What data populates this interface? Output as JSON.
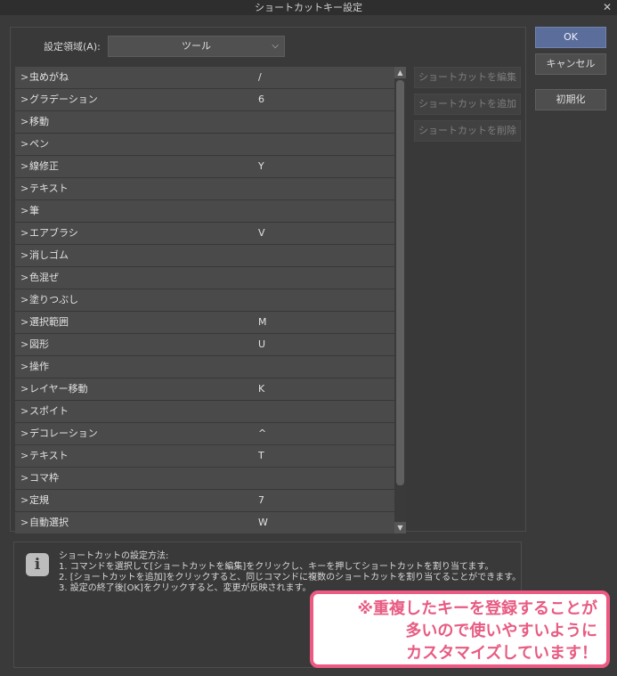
{
  "window": {
    "title": "ショートカットキー設定",
    "close_glyph": "✕"
  },
  "area": {
    "label": "設定領域(A):",
    "selected": "ツール",
    "chevron": "⌵"
  },
  "list": {
    "arrow": ">",
    "items": [
      {
        "name": "虫めがね",
        "key": "/"
      },
      {
        "name": "グラデーション",
        "key": "6"
      },
      {
        "name": "移動",
        "key": ""
      },
      {
        "name": "ペン",
        "key": ""
      },
      {
        "name": "線修正",
        "key": "Y"
      },
      {
        "name": "テキスト",
        "key": ""
      },
      {
        "name": "筆",
        "key": ""
      },
      {
        "name": "エアブラシ",
        "key": "V"
      },
      {
        "name": "消しゴム",
        "key": ""
      },
      {
        "name": "色混ぜ",
        "key": ""
      },
      {
        "name": "塗りつぶし",
        "key": ""
      },
      {
        "name": "選択範囲",
        "key": "M"
      },
      {
        "name": "図形",
        "key": "U"
      },
      {
        "name": "操作",
        "key": ""
      },
      {
        "name": "レイヤー移動",
        "key": "K"
      },
      {
        "name": "スポイト",
        "key": ""
      },
      {
        "name": "デコレーション",
        "key": "^"
      },
      {
        "name": "テキスト",
        "key": "T"
      },
      {
        "name": "コマ枠",
        "key": ""
      },
      {
        "name": "定規",
        "key": "7"
      },
      {
        "name": "自動選択",
        "key": "W"
      }
    ]
  },
  "scroll": {
    "up": "▲",
    "down": "▼"
  },
  "actions": {
    "edit": "ショートカットを編集",
    "add": "ショートカットを追加",
    "delete": "ショートカットを削除"
  },
  "buttons": {
    "ok": "OK",
    "cancel": "キャンセル",
    "reset": "初期化"
  },
  "info": {
    "icon": "i",
    "lines": [
      "ショートカットの設定方法:",
      "1. コマンドを選択して[ショートカットを編集]をクリックし、キーを押してショートカットを割り当てます。",
      "2. [ショートカットを追加]をクリックすると、同じコマンドに複数のショートカットを割り当てることができます。",
      "3. 設定の終了後[OK]をクリックすると、変更が反映されます。"
    ]
  },
  "callout": {
    "lines": [
      "※重複したキーを登録することが",
      "多いので使いやすいように",
      "カスタマイズしています！"
    ],
    "color": "#e85b82"
  }
}
